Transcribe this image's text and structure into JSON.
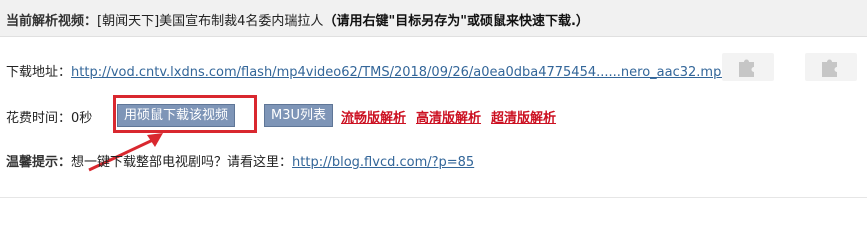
{
  "header": {
    "label": "当前解析视频：",
    "video_title": "[朝闻天下]美国宣布制裁4名委内瑞拉人",
    "hint": "（请用右键\"目标另存为\"或硕鼠来快速下载.）"
  },
  "download": {
    "label": "下载地址：",
    "url": "http://vod.cntv.lxdns.com/flash/mp4video62/TMS/2018/09/26/a0ea0dba4775454......nero_aac32.mp4",
    "plugin_icon_1": "puzzle-plugin-icon",
    "plugin_icon_2": "puzzle-plugin-icon"
  },
  "time": {
    "label": "花费时间：0秒",
    "btn_shuoshu": "用硕鼠下载该视频",
    "btn_m3u": "M3U列表",
    "link_smooth": "流畅版解析",
    "link_hd": "高清版解析",
    "link_superhd": "超清版解析"
  },
  "tip": {
    "label": "温馨提示：",
    "text": "想一键下载整部电视剧吗？请看这里：",
    "link": "http://blog.flvcd.com/?p=85"
  },
  "colors": {
    "accent_red": "#d9282f",
    "button_blue": "#7e95b7",
    "link_blue": "#336699",
    "link_red": "#cc1122"
  }
}
